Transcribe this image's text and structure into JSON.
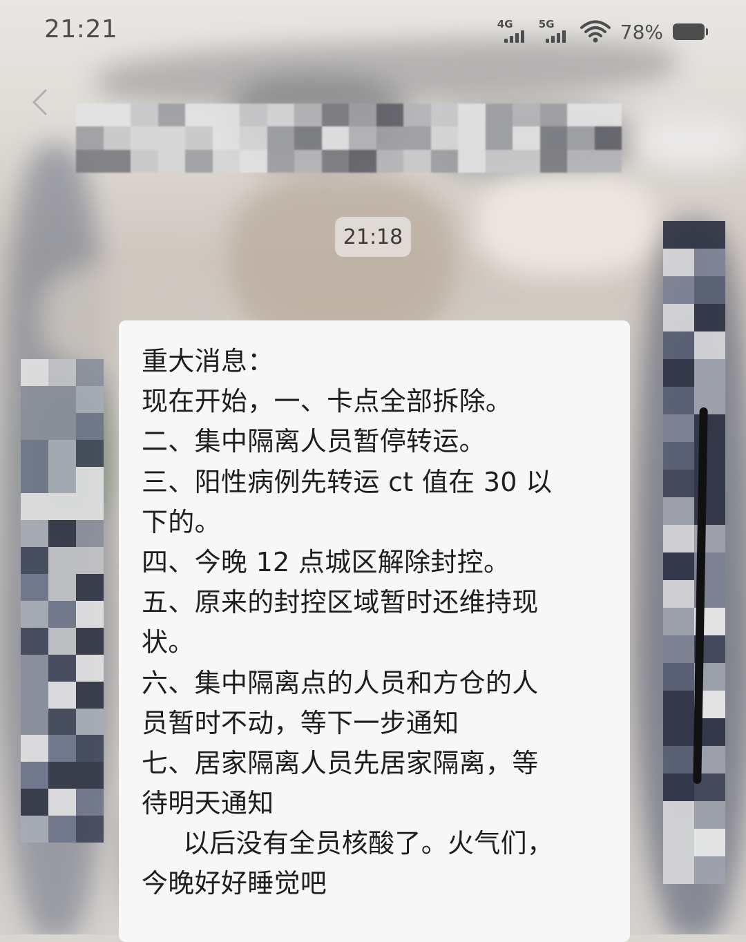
{
  "status_bar": {
    "time": "21:21",
    "signal_1_label": "4G",
    "signal_2_label": "5G",
    "battery_percent": "78%",
    "icons": [
      "signal-4g-icon",
      "signal-5g-icon",
      "wifi-icon",
      "battery-icon"
    ]
  },
  "chat": {
    "timestamp": "21:18",
    "message": {
      "lines": [
        "重大消息：",
        "现在开始，一、卡点全部拆除。",
        "二、集中隔离人员暂停转运。",
        "三、阳性病例先转运 ct 值在 30 以",
        "下的。",
        "四、今晚 12 点城区解除封控。",
        "五、原来的封控区域暂时还维持现",
        "状。",
        "六、集中隔离点的人员和方仓的人",
        "员暂时不动，等下一步通知",
        "七、居家隔离人员先居家隔离，等",
        "待明天通知",
        "以后没有全员核酸了。火气们，",
        "今晚好好睡觉吧"
      ]
    }
  },
  "colors": {
    "bubble_background": "#f7f7f7",
    "text": "#1e1e1e",
    "status_text": "#4d4d4d"
  }
}
